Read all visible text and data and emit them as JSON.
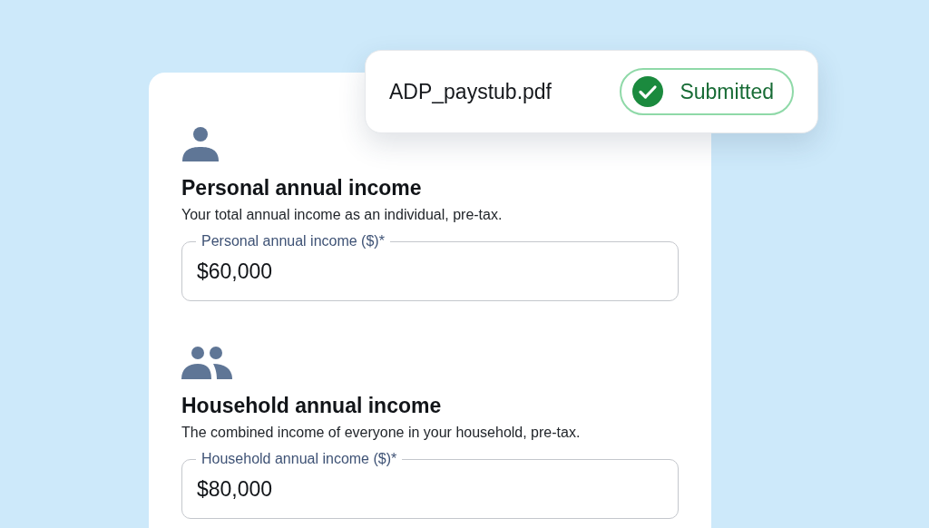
{
  "upload": {
    "file_name": "ADP_paystub.pdf",
    "status": {
      "label": "Submitted",
      "kind": "success"
    }
  },
  "sections": [
    {
      "kind": "person",
      "title": "Personal annual income",
      "description": "Your total annual income as an individual, pre-tax.",
      "field": {
        "label": "Personal annual income ($)*",
        "value": "$60,000"
      }
    },
    {
      "kind": "group",
      "title": "Household annual income",
      "description": "The combined income of everyone in your household, pre-tax.",
      "field": {
        "label": "Household annual income ($)*",
        "value": "$80,000"
      }
    }
  ]
}
